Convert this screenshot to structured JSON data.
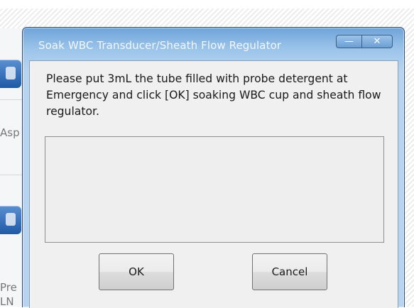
{
  "background": {
    "side_texts": [
      "Asp",
      "Pre",
      "LN"
    ]
  },
  "dialog": {
    "title": "Soak WBC Transducer/Sheath Flow Regulator",
    "minimize_glyph": "—",
    "close_glyph": "✕",
    "message": "Please put 3mL the tube filled with probe detergent at Emergency and click [OK] soaking WBC cup and sheath flow regulator.",
    "status_text": "",
    "ok_label": "OK",
    "cancel_label": "Cancel"
  },
  "icons": {
    "side_button_1": "lock-icon",
    "side_button_2": "lock-icon"
  }
}
